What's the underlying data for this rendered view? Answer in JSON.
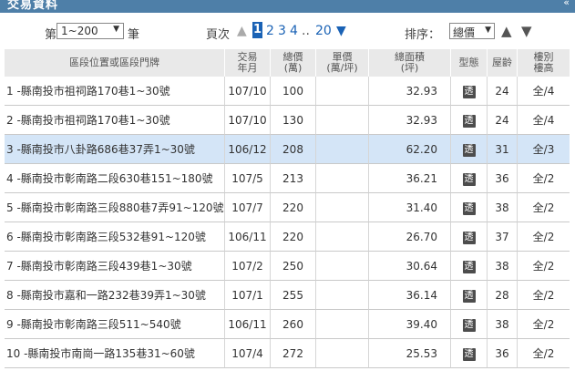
{
  "header": {
    "title": "交易資料",
    "collapse_glyph": "«"
  },
  "controls": {
    "range_prefix": "第",
    "range_value": "1~200",
    "range_suffix": "筆",
    "page_label": "頁次",
    "current_page": "1",
    "pages": [
      "2",
      "3",
      "4"
    ],
    "ellipsis": "..",
    "last_page": "20",
    "sort_label": "排序：",
    "sort_value": "總價"
  },
  "table": {
    "columns": [
      {
        "line1": "區段位置或區段門牌",
        "line2": ""
      },
      {
        "line1": "交易",
        "line2": "年月"
      },
      {
        "line1": "總價",
        "line2": "(萬)"
      },
      {
        "line1": "單價",
        "line2": "(萬/坪)"
      },
      {
        "line1": "總面積",
        "line2": "(坪)"
      },
      {
        "line1": "型態",
        "line2": ""
      },
      {
        "line1": "屋齡",
        "line2": ""
      },
      {
        "line1": "樓別",
        "line2": "樓高"
      }
    ],
    "type_icon_text": "透",
    "rows": [
      {
        "addr": "1 -縣南投市祖祠路170巷1~30號",
        "date": "107/10",
        "price": "100",
        "unit": "",
        "area": "32.93",
        "age": "24",
        "floor": "全/4"
      },
      {
        "addr": "2 -縣南投市祖祠路170巷1~30號",
        "date": "107/10",
        "price": "130",
        "unit": "",
        "area": "32.93",
        "age": "24",
        "floor": "全/4"
      },
      {
        "addr": "3 -縣南投市八卦路686巷37弄1~30號",
        "date": "106/12",
        "price": "208",
        "unit": "",
        "area": "62.20",
        "age": "31",
        "floor": "全/3"
      },
      {
        "addr": "4 -縣南投市彰南路二段630巷151~180號",
        "date": "107/5",
        "price": "213",
        "unit": "",
        "area": "36.21",
        "age": "36",
        "floor": "全/2"
      },
      {
        "addr": "5 -縣南投市彰南路三段880巷7弄91~120號",
        "date": "107/7",
        "price": "220",
        "unit": "",
        "area": "31.40",
        "age": "38",
        "floor": "全/2"
      },
      {
        "addr": "6 -縣南投市彰南路三段532巷91~120號",
        "date": "106/11",
        "price": "220",
        "unit": "",
        "area": "26.70",
        "age": "37",
        "floor": "全/2"
      },
      {
        "addr": "7 -縣南投市彰南路三段439巷1~30號",
        "date": "107/2",
        "price": "250",
        "unit": "",
        "area": "30.64",
        "age": "38",
        "floor": "全/2"
      },
      {
        "addr": "8 -縣南投市嘉和一路232巷39弄1~30號",
        "date": "107/1",
        "price": "255",
        "unit": "",
        "area": "36.14",
        "age": "28",
        "floor": "全/2"
      },
      {
        "addr": "9 -縣南投市彰南路三段511~540號",
        "date": "106/11",
        "price": "260",
        "unit": "",
        "area": "39.40",
        "age": "38",
        "floor": "全/2"
      },
      {
        "addr": "10 -縣南投市南崗一路135巷31~60號",
        "date": "107/4",
        "price": "272",
        "unit": "",
        "area": "25.53",
        "age": "36",
        "floor": "全/2"
      }
    ]
  }
}
